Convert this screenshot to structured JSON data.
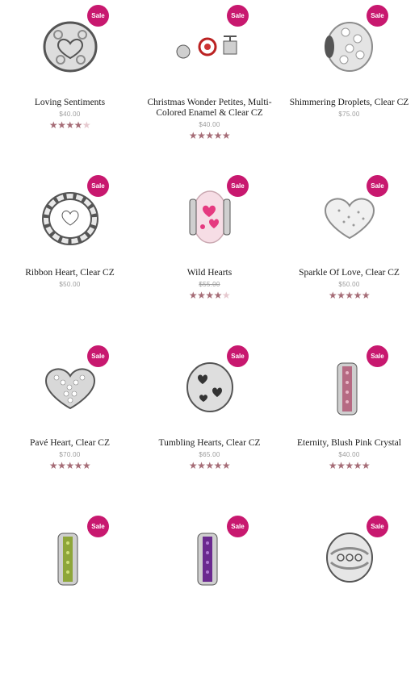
{
  "sale_label": "Sale",
  "colors": {
    "sale_badge": "#c8186f",
    "star_on": "#a66d77",
    "star_off": "#e6c9cf"
  },
  "products": [
    {
      "name": "Loving Sentiments",
      "price": "$40.00",
      "rating": 4,
      "icon": "filigree-heart-charm"
    },
    {
      "name": "Christmas Wonder Petites, Multi-Colored Enamel & Clear CZ",
      "price": "$40.00",
      "rating": 5,
      "icon": "petite-charms"
    },
    {
      "name": "Shimmering Droplets, Clear CZ",
      "price": "$75.00",
      "rating": 0,
      "icon": "pave-droplets-charm"
    },
    {
      "name": "Ribbon Heart, Clear CZ",
      "price": "$50.00",
      "rating": 0,
      "icon": "ribbon-heart-charm"
    },
    {
      "name": "Wild Hearts",
      "price": "$55.00",
      "rating": 4.5,
      "strike": true,
      "icon": "pink-glass-heart-charm"
    },
    {
      "name": "Sparkle Of Love, Clear CZ",
      "price": "$50.00",
      "rating": 5,
      "icon": "heart-charm"
    },
    {
      "name": "Pavé Heart, Clear CZ",
      "price": "$70.00",
      "rating": 5,
      "icon": "pave-heart-charm"
    },
    {
      "name": "Tumbling Hearts, Clear CZ",
      "price": "$65.00",
      "rating": 5,
      "icon": "tumbling-hearts-charm"
    },
    {
      "name": "Eternity, Blush Pink Crystal",
      "price": "$40.00",
      "rating": 5,
      "icon": "pink-spacer-charm"
    },
    {
      "name": "",
      "price": "",
      "rating": 0,
      "icon": "green-spacer-charm"
    },
    {
      "name": "",
      "price": "",
      "rating": 0,
      "icon": "purple-spacer-charm"
    },
    {
      "name": "",
      "price": "",
      "rating": 0,
      "icon": "openwork-charm"
    }
  ]
}
